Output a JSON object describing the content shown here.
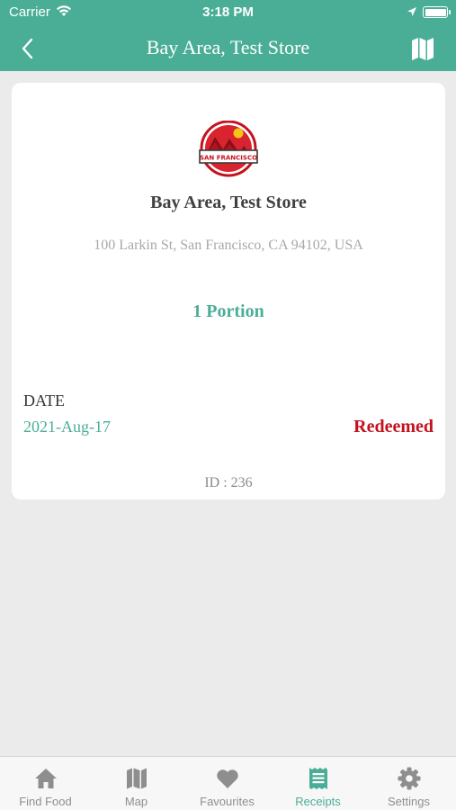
{
  "status_bar": {
    "carrier": "Carrier",
    "time": "3:18 PM"
  },
  "nav": {
    "title": "Bay Area, Test Store",
    "back_icon": "chevron-left-icon",
    "map_icon": "map-icon"
  },
  "receipt": {
    "logo_text": "SAN FRANCISCO",
    "store_name": "Bay Area, Test Store",
    "address": "100 Larkin St, San Francisco, CA 94102, USA",
    "portion": "1 Portion",
    "date_label": "DATE",
    "date_value": "2021-Aug-17",
    "status": "Redeemed",
    "id_text": "ID : 236"
  },
  "tabs": [
    {
      "label": "Find Food",
      "icon": "home-icon",
      "active": false
    },
    {
      "label": "Map",
      "icon": "map-icon",
      "active": false
    },
    {
      "label": "Favourites",
      "icon": "heart-icon",
      "active": false
    },
    {
      "label": "Receipts",
      "icon": "receipt-icon",
      "active": true
    },
    {
      "label": "Settings",
      "icon": "gear-icon",
      "active": false
    }
  ],
  "colors": {
    "brand": "#4aae96",
    "redeemed": "#c3121d",
    "background": "#ebebeb"
  }
}
